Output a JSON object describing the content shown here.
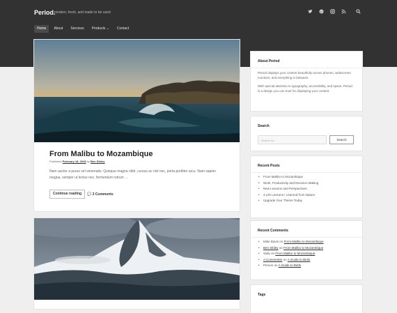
{
  "site": {
    "logo": "Period.",
    "tagline": "modern, fresh, and made to be used"
  },
  "social": [
    {
      "icon": "twitter-icon",
      "glyph": "🐦"
    },
    {
      "icon": "pinterest-icon",
      "glyph": "✿"
    },
    {
      "icon": "instagram-icon",
      "glyph": "◎"
    },
    {
      "icon": "rss-icon",
      "glyph": "◔"
    },
    {
      "icon": "search-icon",
      "glyph": "⚲"
    }
  ],
  "nav": {
    "home": "Home",
    "about": "About",
    "services": "Services",
    "products": "Products ⌄",
    "contact": "Contact"
  },
  "post1": {
    "title": "From Malibu to Mozambique",
    "published_label": "Published",
    "date": "February 18, 2015",
    "by_label": "by",
    "author": "Ben Sibley",
    "excerpt": "Nam auctor a purus vel venenatis. Quisque magna nibh, cursus ac nisl nec, porta porttitor arcu. Nam sapien magna, semper ut lectus nec, fermentum rutrum …",
    "continue_label": "Continue reading",
    "comments_label": "3 Comments"
  },
  "about": {
    "heading": "About Period",
    "p1": "Period displays your content beautifully across phones, widescreen monitors, and everything in between.",
    "p2": "With special attention to typography, accessibility, and space, Period is a design you can trust for displaying your content."
  },
  "search": {
    "heading": "Search",
    "placeholder": "Search for...",
    "button": "Search"
  },
  "recent_posts": {
    "heading": "Recent Posts",
    "items": [
      "From Malibu to Mozambique",
      "Work, Productivity and Decision Making",
      "New Lessons and Perspectives",
      "3 Life Lessons I Learned from Nature",
      "Upgrade Your Theme Today"
    ]
  },
  "recent_comments": {
    "heading": "Recent Comments",
    "on": "on",
    "items": [
      {
        "who": "Mike Davis",
        "who_link": false,
        "post": "From Malibu to Mozambique"
      },
      {
        "who": "Ben Sibley",
        "who_link": true,
        "post": "From Malibu to Mozambique"
      },
      {
        "who": "Sally",
        "who_link": false,
        "post": "From Malibu to Mozambique"
      },
      {
        "who": "A Commenter",
        "who_link": true,
        "post": "A Guide to Birds"
      },
      {
        "who": "Person",
        "who_link": false,
        "post": "A Guide to Birds"
      }
    ]
  },
  "tags": {
    "heading": "Tags"
  }
}
